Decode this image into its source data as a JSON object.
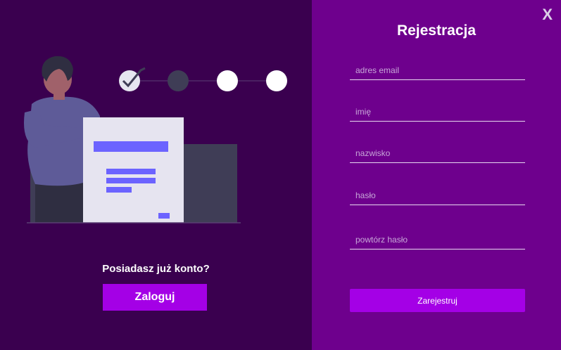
{
  "left": {
    "question": "Posiadasz już konto?",
    "login_label": "Zaloguj"
  },
  "right": {
    "close_label": "X",
    "title": "Rejestracja",
    "fields": {
      "email_placeholder": "adres email",
      "first_name_placeholder": "imię",
      "last_name_placeholder": "nazwisko",
      "password_placeholder": "hasło",
      "password_repeat_placeholder": "powtórz hasło"
    },
    "submit_label": "Zarejestruj"
  },
  "illustration": {
    "steps_completed": 1,
    "steps_total": 4,
    "active_step": 2
  },
  "colors": {
    "left_bg": "#3a004f",
    "right_bg": "#6e008d",
    "button": "#a400e6",
    "accent": "#6c63ff"
  }
}
